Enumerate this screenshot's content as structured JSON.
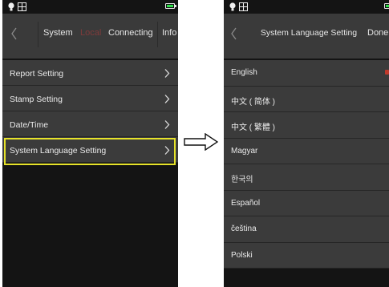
{
  "left_screen": {
    "tabs": [
      {
        "label": "System"
      },
      {
        "label": "Local"
      },
      {
        "label": "Connecting"
      },
      {
        "label": "Info"
      }
    ],
    "items": [
      {
        "label": "Report Setting"
      },
      {
        "label": "Stamp Setting"
      },
      {
        "label": "Date/Time"
      },
      {
        "label": "System Language Setting"
      }
    ],
    "highlighted_item": "System Language Setting"
  },
  "right_screen": {
    "title": "System Language Setting",
    "done_label": "Done",
    "languages": [
      {
        "label": "English"
      },
      {
        "label": "中文 ( 简体 )"
      },
      {
        "label": "中文 ( 繁體 )"
      },
      {
        "label": "Magyar"
      },
      {
        "label": "한국의"
      },
      {
        "label": "Español"
      },
      {
        "label": "čeština"
      },
      {
        "label": "Polski"
      }
    ],
    "selected_language": "English"
  },
  "colors": {
    "highlight": "#e6e22a",
    "battery": "#2fe04a",
    "local_tab": "#d23a3a"
  },
  "icons": [
    "bulb-icon",
    "grid-icon",
    "battery-icon",
    "back-icon",
    "chevron-right-icon",
    "arrow-right-icon"
  ]
}
